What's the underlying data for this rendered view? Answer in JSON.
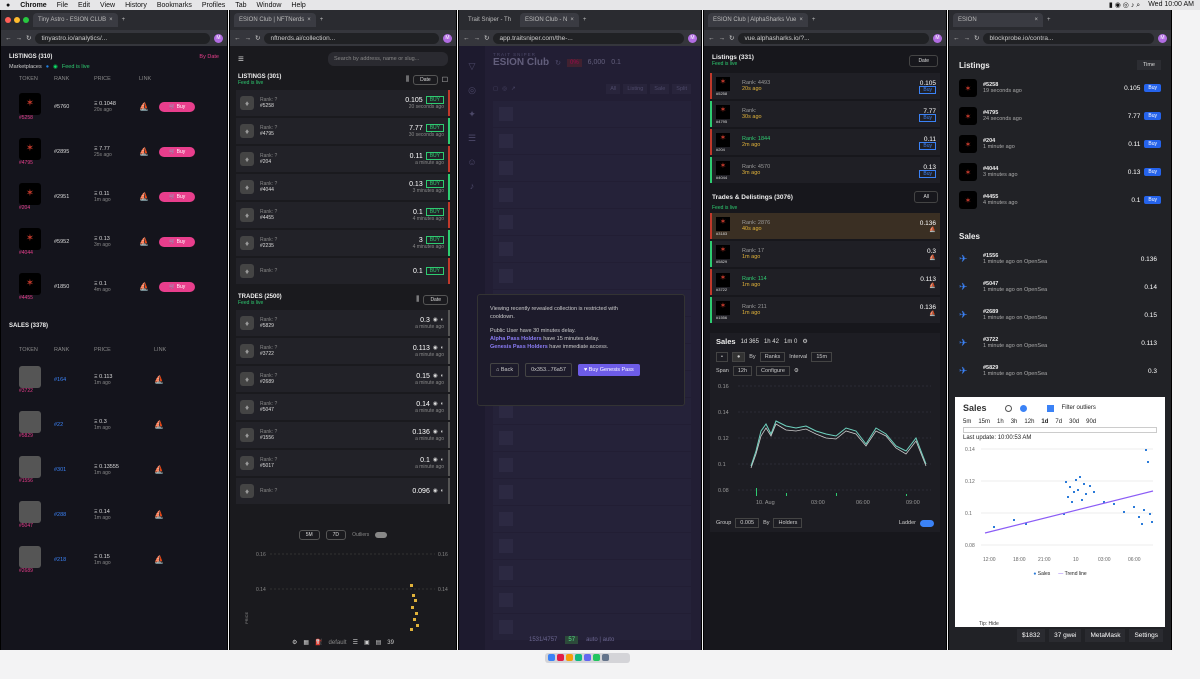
{
  "menubar": {
    "app": "Chrome",
    "items": [
      "File",
      "Edit",
      "View",
      "History",
      "Bookmarks",
      "Profiles",
      "Tab",
      "Window",
      "Help"
    ],
    "clock": "Wed 10:00 AM"
  },
  "w1": {
    "tab": "Tiny Astro - ESION CLUB",
    "url": "tinyastro.io/analytics/...",
    "listings_title": "LISTINGS (310)",
    "sort": "By Date",
    "marketplaces": "Marketplaces",
    "feed": "Feed is live",
    "cols": [
      "TOKEN",
      "RANK",
      "PRICE",
      "LINK"
    ],
    "listings": [
      {
        "id": "#5258",
        "rank": "#5760",
        "price": "Ξ 0.1048",
        "ago": "20s ago"
      },
      {
        "id": "#4795",
        "rank": "#2895",
        "price": "Ξ 7.77",
        "ago": "25s ago"
      },
      {
        "id": "#204",
        "rank": "#2951",
        "price": "Ξ 0.11",
        "ago": "1m ago"
      },
      {
        "id": "#4044",
        "rank": "#5952",
        "price": "Ξ 0.13",
        "ago": "3m ago"
      },
      {
        "id": "#4455",
        "rank": "#1850",
        "price": "Ξ 0.1",
        "ago": "4m ago"
      }
    ],
    "buy": "Buy",
    "sales_title": "SALES (3378)",
    "sales_cols": [
      "TOKEN",
      "RANK",
      "PRICE",
      "LINK"
    ],
    "sales": [
      {
        "id": "#3722",
        "rank": "#164",
        "price": "Ξ 0.113",
        "ago": "1m ago"
      },
      {
        "id": "#5829",
        "rank": "#22",
        "price": "Ξ 0.3",
        "ago": "1m ago"
      },
      {
        "id": "#1556",
        "rank": "#301",
        "price": "Ξ 0.13555",
        "ago": "1m ago"
      },
      {
        "id": "#5047",
        "rank": "#288",
        "price": "Ξ 0.14",
        "ago": "1m ago"
      },
      {
        "id": "#2689",
        "rank": "#218",
        "price": "Ξ 0.15",
        "ago": "1m ago"
      }
    ]
  },
  "w2": {
    "tab": "ESION Club | NFTNerds",
    "url": "nftnerds.ai/collection...",
    "search": "Search by address, name or slug...",
    "listings_title": "LISTINGS (301)",
    "feed": "Feed is live",
    "date": "Date",
    "listings": [
      {
        "id": "#5258",
        "price": "0.105",
        "ago": "20 seconds ago"
      },
      {
        "id": "#4795",
        "price": "7.77",
        "ago": "30 seconds ago"
      },
      {
        "id": "#204",
        "price": "0.11",
        "ago": "a minute ago"
      },
      {
        "id": "#4044",
        "price": "0.13",
        "ago": "3 minutes ago"
      },
      {
        "id": "#4455",
        "price": "0.1",
        "ago": "4 minutes ago"
      },
      {
        "id": "#2235",
        "price": "3",
        "ago": "4 minutes ago"
      },
      {
        "id": "",
        "price": "0.1",
        "ago": ""
      }
    ],
    "rank": "Rank: ?",
    "buy": "BUY",
    "trades_title": "TRADES (2500)",
    "trades": [
      {
        "id": "#5829",
        "price": "0.3",
        "ago": "a minute ago"
      },
      {
        "id": "#3722",
        "price": "0.113",
        "ago": "a minute ago"
      },
      {
        "id": "#2689",
        "price": "0.15",
        "ago": "a minute ago"
      },
      {
        "id": "#5047",
        "price": "0.14",
        "ago": "a minute ago"
      },
      {
        "id": "#1556",
        "price": "0.136",
        "ago": "a minute ago"
      },
      {
        "id": "#5017",
        "price": "0.1",
        "ago": "a minute ago"
      },
      {
        "id": "",
        "price": "0.096",
        "ago": ""
      }
    ],
    "chart_controls": [
      "5M",
      "7D",
      "Outliers"
    ],
    "y_ticks": [
      "0.16",
      "0.14"
    ],
    "ylabel": "PRICE",
    "footer": "default",
    "footer_count": "39"
  },
  "w3": {
    "tabs": [
      "Trait Sniper - Th",
      "ESION Club - N"
    ],
    "url": "app.traitsniper.com/the-...",
    "title": "ESION Club",
    "brand": "TRAIT SNIPER",
    "pct": "0%",
    "count": "6,000",
    "floor": "0.1",
    "filters": [
      "All",
      "Listing",
      "Sale",
      "Split"
    ],
    "modal": {
      "line1": "Viewing recently revealed collection is restricted with cooldown.",
      "line2": "Public User have 30 minutes delay.",
      "alpha": "Alpha Pass Holders",
      "alpha_rest": " have 15 minutes delay.",
      "genesis": "Genesis Pass Holders",
      "genesis_rest": " have immediate access.",
      "back": "Back",
      "addr": "0x353...76a57",
      "cta": "Buy Genesis Pass"
    },
    "footer": "1531/4757",
    "footer_num": "57",
    "footer_mode": "auto | auto"
  },
  "w4": {
    "tab": "ESION Club | AlphaSharks Vue",
    "url": "vue.alphasharks.io/?...",
    "listings_title": "Listings (331)",
    "feed": "Feed is live",
    "date": "Date",
    "listings": [
      {
        "id": "#5258",
        "rank": "Rank: 4493",
        "price": "0.105",
        "ago": "20s ago"
      },
      {
        "id": "#4795",
        "rank": "Rank:",
        "price": "7.77",
        "ago": "30s ago"
      },
      {
        "id": "#204",
        "rank": "Rank: 1844",
        "price": "0.11",
        "ago": "2m ago"
      },
      {
        "id": "#4044",
        "rank": "Rank: 4570",
        "price": "0.13",
        "ago": "3m ago"
      }
    ],
    "trades_title": "Trades & Delistings (3076)",
    "all": "All",
    "trades": [
      {
        "id": "#3183",
        "rank": "Rank: 2876",
        "price": "0.136",
        "ago": "40s ago"
      },
      {
        "id": "#5829",
        "rank": "Rank: 17",
        "price": "0.3",
        "ago": "1m ago"
      },
      {
        "id": "#3722",
        "rank": "Rank: 114",
        "price": "0.113",
        "ago": "1m ago"
      },
      {
        "id": "#1556",
        "rank": "Rank: 211",
        "price": "0.136",
        "ago": "1m ago"
      }
    ],
    "buy": "Buy",
    "sales": "Sales",
    "stats": [
      "1d 365",
      "1h 42",
      "1m 0"
    ],
    "by": "By",
    "ranks": "Ranks",
    "interval": "Interval",
    "interval_v": "15m",
    "span": "Span",
    "span_v": "12h",
    "configure": "Configure",
    "y_ticks": [
      "0.16",
      "0.14",
      "0.12",
      "0.1",
      "0.08"
    ],
    "x_ticks": [
      "10. Aug",
      "03:00",
      "06:00",
      "09:00"
    ],
    "group": "Group",
    "group_v": "0.005",
    "holders": "Holders",
    "ladder": "Ladder"
  },
  "w5": {
    "tab": "ESION",
    "url": "blockprobe.io/contra...",
    "listings_title": "Listings",
    "time": "Time",
    "listings": [
      {
        "id": "#5258",
        "ago": "19 seconds ago",
        "price": "0.105"
      },
      {
        "id": "#4795",
        "ago": "24 seconds ago",
        "price": "7.77"
      },
      {
        "id": "#204",
        "ago": "1 minute ago",
        "price": "0.11"
      },
      {
        "id": "#4044",
        "ago": "3 minutes ago",
        "price": "0.13"
      },
      {
        "id": "#4455",
        "ago": "4 minutes ago",
        "price": "0.1"
      }
    ],
    "buy": "Buy",
    "sales_title": "Sales",
    "sales": [
      {
        "id": "#1556",
        "ago": "1 minute ago on OpenSea",
        "price": "0.136"
      },
      {
        "id": "#5047",
        "ago": "1 minute ago on OpenSea",
        "price": "0.14"
      },
      {
        "id": "#2689",
        "ago": "1 minute ago on OpenSea",
        "price": "0.15"
      },
      {
        "id": "#3722",
        "ago": "1 minute ago on OpenSea",
        "price": "0.113"
      },
      {
        "id": "#5829",
        "ago": "1 minute ago on OpenSea",
        "price": "0.3"
      }
    ],
    "chart_title": "Sales",
    "ranges": [
      "5m",
      "15m",
      "1h",
      "3h",
      "12h",
      "1d",
      "7d",
      "30d",
      "90d"
    ],
    "filter": "Filter outliers",
    "last_update": "Last update: 10:00:53 AM",
    "y_ticks": [
      "0.14",
      "0.12",
      "0.1",
      "0.08"
    ],
    "x_ticks": [
      "12:00",
      "18:00",
      "21:00",
      "10",
      "03:00",
      "06:00"
    ],
    "legend": [
      "Sales",
      "Trend line"
    ],
    "tip": "Tip: Hide",
    "bottom": [
      "$1832",
      "37 gwei",
      "MetaMask",
      "Settings"
    ]
  }
}
